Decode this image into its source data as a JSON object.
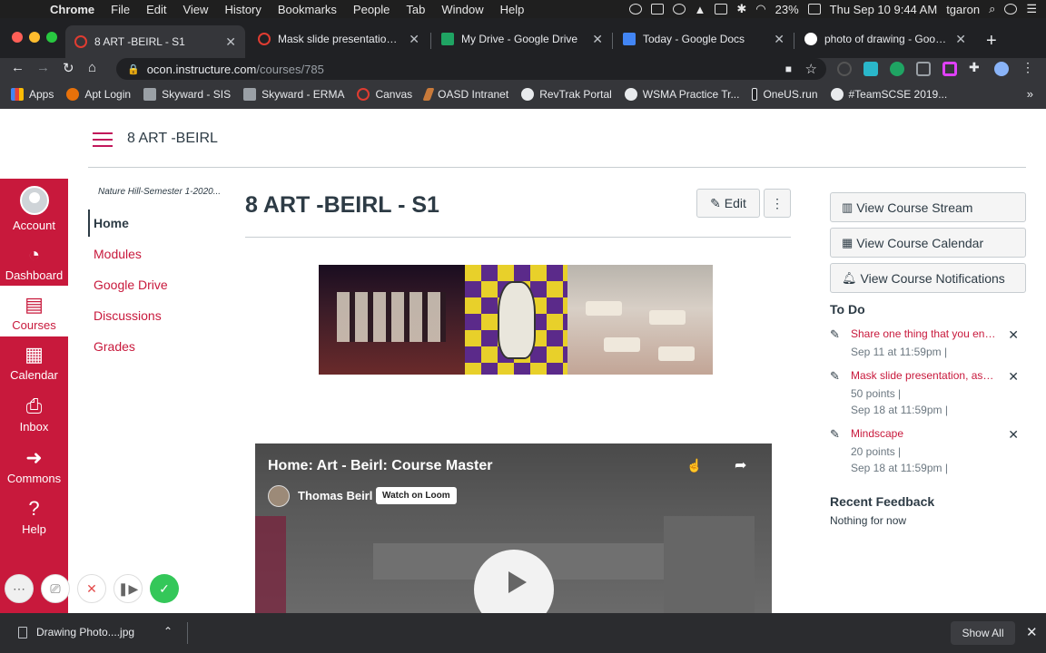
{
  "menubar": {
    "app": "Chrome",
    "items": [
      "File",
      "Edit",
      "View",
      "History",
      "Bookmarks",
      "People",
      "Tab",
      "Window",
      "Help"
    ],
    "battery": "23%",
    "clock": "Thu Sep 10  9:44 AM",
    "user": "tgaron"
  },
  "tabs": [
    {
      "title": "8 ART -BEIRL - S1",
      "favicon_color": "#e03c31"
    },
    {
      "title": "Mask slide presentation, assignment",
      "favicon_color": "#e03c31"
    },
    {
      "title": "My Drive - Google Drive",
      "favicon_color": "#1fa463"
    },
    {
      "title": "Today - Google Docs",
      "favicon_color": "#4285f4"
    },
    {
      "title": "photo of drawing - Google Search",
      "favicon_color": "#ffffff"
    }
  ],
  "address": {
    "host": "ocon.instructure.com",
    "path": "/courses/785"
  },
  "bookmarks": [
    {
      "label": "Apps",
      "color": "#4285f4"
    },
    {
      "label": "Apt Login",
      "color": "#e8710a"
    },
    {
      "label": "Skyward - SIS",
      "color": "#9aa0a6"
    },
    {
      "label": "Skyward - ERMA",
      "color": "#9aa0a6"
    },
    {
      "label": "Canvas",
      "color": "#e03c31"
    },
    {
      "label": "OASD Intranet",
      "color": "#c97a3a"
    },
    {
      "label": "RevTrak Portal",
      "color": "#e8eaed"
    },
    {
      "label": "WSMA Practice Tr...",
      "color": "#e8eaed"
    },
    {
      "label": "OneUS.run",
      "color": "#202124"
    },
    {
      "label": "#TeamSCSE 2019...",
      "color": "#e8eaed"
    }
  ],
  "course": {
    "crumb": "8 ART -BEIRL",
    "term": "Nature Hill-Semester 1-2020...",
    "title": "8 ART -BEIRL - S1",
    "edit_label": "Edit",
    "kebab": "⋮"
  },
  "globalnav": [
    {
      "label": "Account",
      "icon": "avatar"
    },
    {
      "label": "Dashboard",
      "icon": "dashboard-icon"
    },
    {
      "label": "Courses",
      "icon": "courses-icon"
    },
    {
      "label": "Calendar",
      "icon": "calendar-icon"
    },
    {
      "label": "Inbox",
      "icon": "inbox-icon"
    },
    {
      "label": "Commons",
      "icon": "commons-icon"
    },
    {
      "label": "Help",
      "icon": "help-icon"
    }
  ],
  "coursenav": [
    "Home",
    "Modules",
    "Google Drive",
    "Discussions",
    "Grades"
  ],
  "video": {
    "title": "Home: Art - Beirl: Course Master",
    "author": "Thomas Beirl",
    "watch_label": "Watch on Loom"
  },
  "sidebar": {
    "buttons": [
      "View Course Stream",
      "View Course Calendar",
      "View Course Notifications"
    ],
    "todo_heading": "To Do",
    "todos": [
      {
        "title": "Share one thing that you enjoy",
        "meta": [
          "Sep 11 at 11:59pm  |"
        ]
      },
      {
        "title": "Mask slide presentation, assignment",
        "meta": [
          "50 points  |",
          "Sep 18 at 11:59pm  |"
        ]
      },
      {
        "title": "Mindscape",
        "meta": [
          "20 points  |",
          "Sep 18 at 11:59pm  |"
        ]
      }
    ],
    "feedback_heading": "Recent Feedback",
    "feedback_empty": "Nothing for now"
  },
  "download": {
    "file": "Drawing Photo....jpg",
    "show_all": "Show All"
  },
  "colors": {
    "brand": "#c8193c",
    "text": "#2d3b45"
  }
}
